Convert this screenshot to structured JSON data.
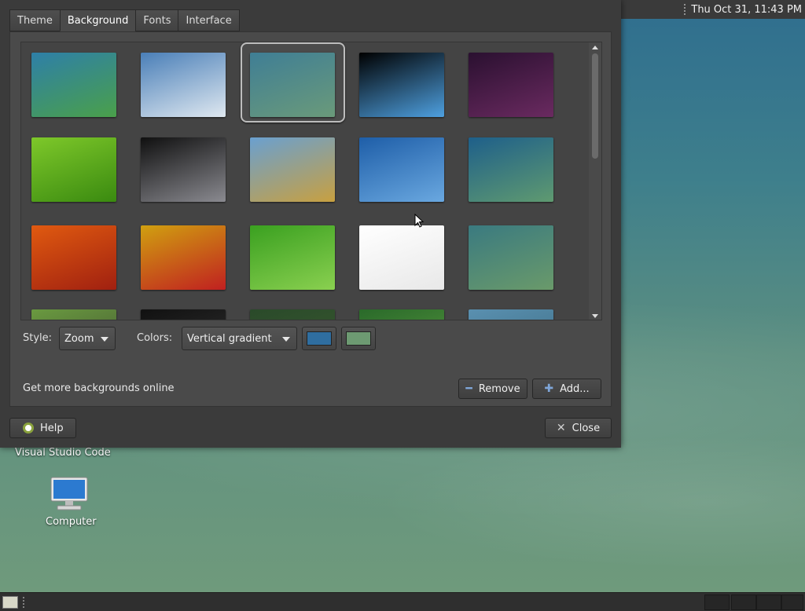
{
  "top_panel": {
    "clock": "Thu Oct 31, 11:43 PM"
  },
  "desktop": {
    "icons": [
      {
        "label": "Visual Studio Code"
      },
      {
        "label": "Computer"
      }
    ]
  },
  "dialog": {
    "tabs": [
      {
        "label": "Theme"
      },
      {
        "label": "Background"
      },
      {
        "label": "Fonts"
      },
      {
        "label": "Interface"
      }
    ],
    "active_tab": "Background",
    "gallery": {
      "thumbnails": [
        {
          "name": "blue-green-gradient",
          "colors": [
            "#2e7fa8",
            "#4aa04a"
          ]
        },
        {
          "name": "water-drop",
          "colors": [
            "#4a7fb8",
            "#dfe8f0"
          ]
        },
        {
          "name": "vertical-gradient-selected",
          "colors": [
            "#3f7e95",
            "#6a9a7a"
          ]
        },
        {
          "name": "arch-prism",
          "colors": [
            "#000000",
            "#4ea0e0"
          ]
        },
        {
          "name": "space-arch",
          "colors": [
            "#2a1030",
            "#6a2a60"
          ]
        },
        {
          "name": "green-leaf",
          "colors": [
            "#7ec82a",
            "#3a8a10"
          ]
        },
        {
          "name": "spiral-galaxy",
          "colors": [
            "#101010",
            "#8a8a90"
          ]
        },
        {
          "name": "wheat-field",
          "colors": [
            "#6aa0d0",
            "#c8a040"
          ]
        },
        {
          "name": "blue-waves",
          "colors": [
            "#1e5ea8",
            "#6aa8e0"
          ]
        },
        {
          "name": "teal-bubbles",
          "colors": [
            "#1e5f8a",
            "#5f9a70"
          ]
        },
        {
          "name": "orange-flower",
          "colors": [
            "#e05a10",
            "#a02010"
          ]
        },
        {
          "name": "red-flower",
          "colors": [
            "#d0a010",
            "#c02020"
          ]
        },
        {
          "name": "green-grass",
          "colors": [
            "#3aa020",
            "#8ad050"
          ]
        },
        {
          "name": "white-logo",
          "colors": [
            "#ffffff",
            "#e8e8e8"
          ]
        },
        {
          "name": "gradient-swirl",
          "colors": [
            "#3a7a80",
            "#6a9a6a"
          ]
        }
      ],
      "selected_index": 2
    },
    "style_label": "Style:",
    "style_value": "Zoom",
    "colors_label": "Colors:",
    "colors_value": "Vertical gradient",
    "color1": "#2f6ea0",
    "color2": "#6d9a72",
    "more_online": "Get more backgrounds online",
    "remove_label": "Remove",
    "add_label": "Add...",
    "help_label": "Help",
    "close_label": "Close"
  }
}
